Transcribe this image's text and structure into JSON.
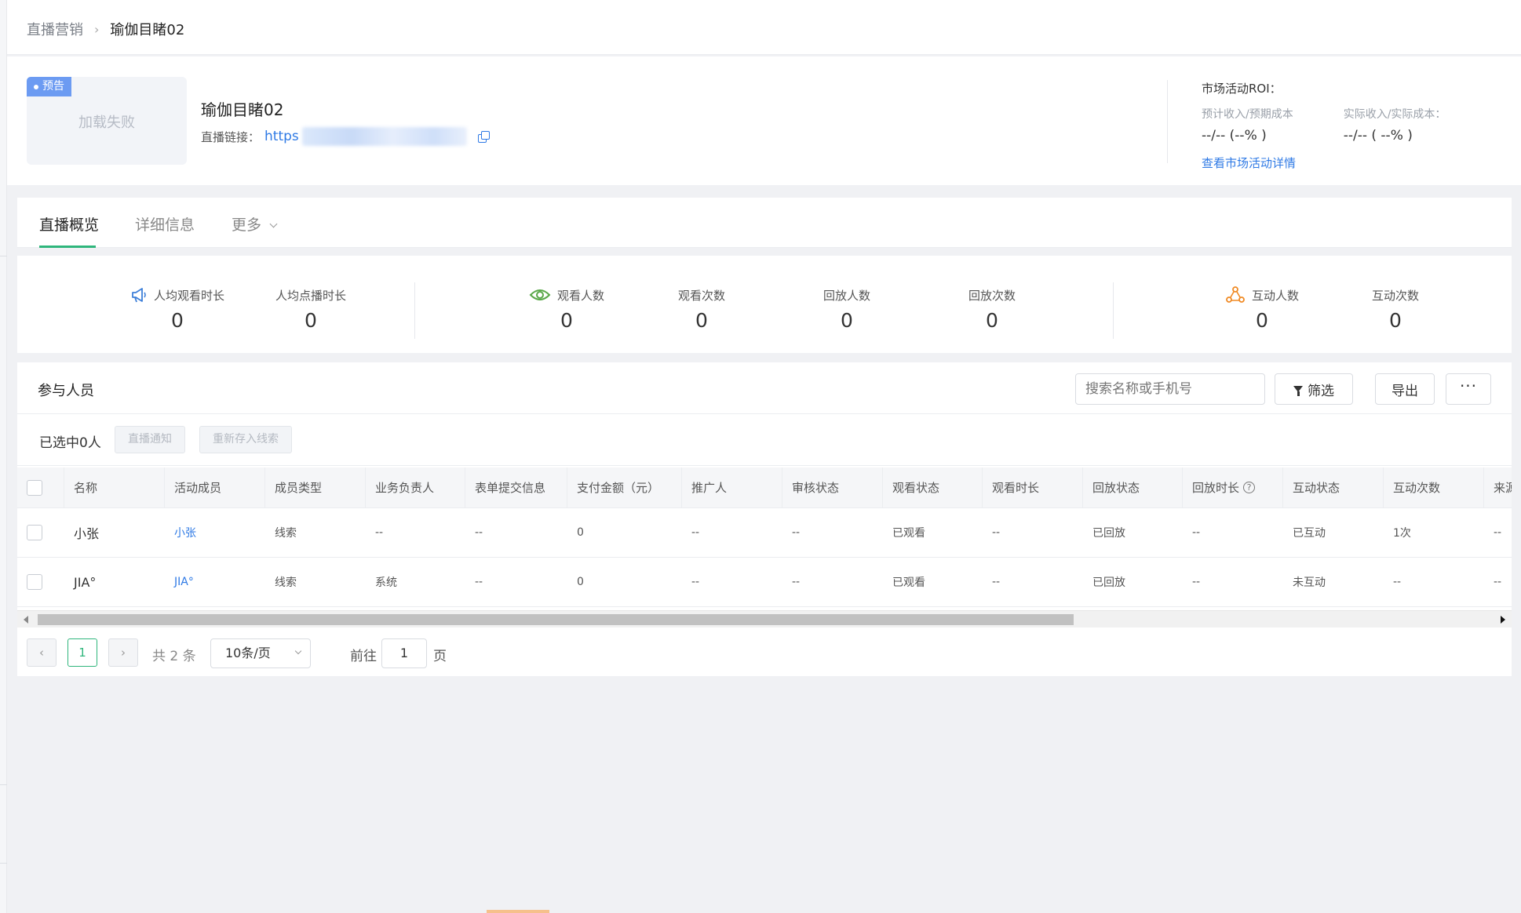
{
  "breadcrumb": {
    "parent": "直播营销",
    "current": "瑜伽目睹02"
  },
  "live": {
    "badge": "预告",
    "cover_status": "加载失败",
    "title": "瑜伽目睹02",
    "link_label": "直播链接：",
    "link_url": "https"
  },
  "roi": {
    "title": "市场活动ROI：",
    "expected_label": "预计收入/预期成本",
    "expected_value": "--/-- (--% )",
    "actual_label": "实际收入/实际成本：",
    "actual_value": "--/-- ( --% )",
    "detail_link": "查看市场活动详情"
  },
  "tabs": [
    "直播概览",
    "详细信息",
    "更多"
  ],
  "stats": [
    {
      "label": "人均观看时长",
      "value": "0",
      "icon": "megaphone-icon",
      "color": "#3d7fd9"
    },
    {
      "label": "人均点播时长",
      "value": "0"
    },
    {
      "label": "观看人数",
      "value": "0",
      "icon": "eye-icon",
      "color": "#5aa84a"
    },
    {
      "label": "观看次数",
      "value": "0"
    },
    {
      "label": "回放人数",
      "value": "0"
    },
    {
      "label": "回放次数",
      "value": "0"
    },
    {
      "label": "互动人数",
      "value": "0",
      "icon": "interaction-icon",
      "color": "#f08a24"
    },
    {
      "label": "互动次数",
      "value": "0"
    }
  ],
  "participants": {
    "title": "参与人员",
    "search_placeholder": "搜索名称或手机号",
    "filter_label": "筛选",
    "export_label": "导出",
    "more_label": "···",
    "selected_text": "已选中0人",
    "notify_label": "直播通知",
    "resave_label": "重新存入线索",
    "columns": [
      "名称",
      "活动成员",
      "成员类型",
      "业务负责人",
      "表单提交信息",
      "支付金额（元）",
      "推广人",
      "审核状态",
      "观看状态",
      "观看时长",
      "回放状态",
      "回放时长",
      "互动状态",
      "互动次数",
      "来源"
    ],
    "rows": [
      [
        "小张",
        "小张",
        "线索",
        "--",
        "--",
        "0",
        "--",
        "--",
        "已观看",
        "--",
        "已回放",
        "--",
        "已互动",
        "1次",
        "--"
      ],
      [
        "JIA°",
        "JIA°",
        "线索",
        "系统",
        "--",
        "0",
        "--",
        "--",
        "已观看",
        "--",
        "已回放",
        "--",
        "未互动",
        "--",
        "--"
      ]
    ]
  },
  "pagination": {
    "current_page": "1",
    "total_text": "共 2 条",
    "page_size": "10条/页",
    "goto_label": "前往",
    "goto_value": "1",
    "page_suffix": "页"
  },
  "colors": {
    "accent_green": "#2fb67c",
    "link_blue": "#2f7ae5",
    "badge_blue": "#6c9bf2"
  }
}
